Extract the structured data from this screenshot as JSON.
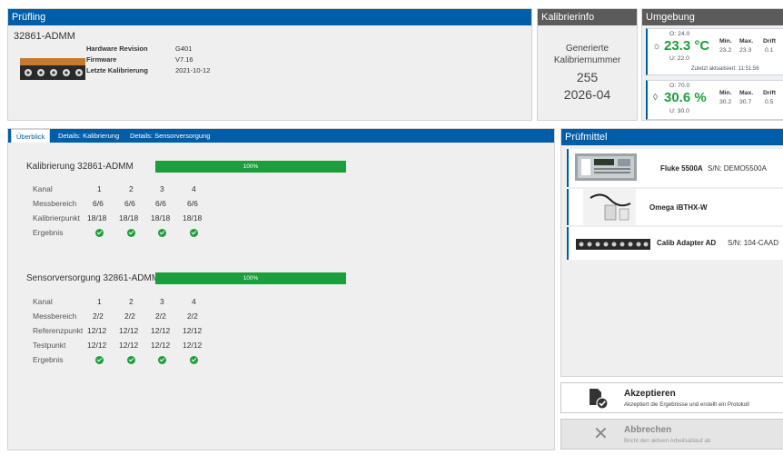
{
  "pruefling": {
    "header": "Prüfling",
    "device_name": "32861-ADMM",
    "hardware_label": "Hardware Revision",
    "hardware_value": "G401",
    "firmware_label": "Firmware",
    "firmware_value": "V7.16",
    "lastcal_label": "Letzte Kalibrierung",
    "lastcal_value": "2021-10-12"
  },
  "kalibrierinfo": {
    "header": "Kalibrierinfo",
    "line1": "Generierte",
    "line2": "Kalibriernummer",
    "number": "255",
    "date": "2026-04"
  },
  "umgebung": {
    "header": "Umgebung",
    "temp": {
      "o": "O: 24.0",
      "value": "23.3 °C",
      "u": "U: 22.0",
      "min_label": "Min.",
      "max_label": "Max.",
      "drift_label": "Drift",
      "min": "23.2",
      "max": "23.3",
      "drift": "0.1"
    },
    "updated": "Zuletzt aktualisiert: 11:51:56",
    "hum": {
      "o": "O: 70.0",
      "value": "30.6 %",
      "u": "U: 30.0",
      "min_label": "Min.",
      "max_label": "Max.",
      "drift_label": "Drift",
      "min": "30.2",
      "max": "30.7",
      "drift": "0.5"
    }
  },
  "tabs": [
    {
      "label": "Überblick"
    },
    {
      "label": "Details: Kalibrierung"
    },
    {
      "label": "Details: Sensorversorgung"
    }
  ],
  "kalibrierung": {
    "title": "Kalibrierung 32861-ADMM",
    "progress": 100,
    "progress_label": "100%",
    "rows": [
      "Kanal",
      "Messbereich",
      "Kalibrierpunkt",
      "Ergebnis"
    ],
    "channels": [
      "1",
      "2",
      "3",
      "4"
    ],
    "messbereich": [
      "6/6",
      "6/6",
      "6/6",
      "6/6"
    ],
    "punkt": [
      "18/18",
      "18/18",
      "18/18",
      "18/18"
    ]
  },
  "sensor": {
    "title": "Sensorversorgung 32861-ADMM",
    "progress": 100,
    "progress_label": "100%",
    "rows": [
      "Kanal",
      "Messbereich",
      "Referenzpunkt",
      "Testpunkt",
      "Ergebnis"
    ],
    "channels": [
      "1",
      "2",
      "3",
      "4"
    ],
    "messbereich": [
      "2/2",
      "2/2",
      "2/2",
      "2/2"
    ],
    "referenz": [
      "12/12",
      "12/12",
      "12/12",
      "12/12"
    ],
    "test": [
      "12/12",
      "12/12",
      "12/12",
      "12/12"
    ]
  },
  "pruefmittel": {
    "header": "Prüfmittel",
    "items": [
      {
        "name": "Fluke 5500A",
        "serial": "S/N: DEMO5500A"
      },
      {
        "name": "Omega iBTHX-W",
        "serial": ""
      },
      {
        "name": "Calib Adapter AD",
        "serial": "S/N: 104-CAAD"
      }
    ]
  },
  "actions": {
    "accept_title": "Akzeptieren",
    "accept_sub": "Akzeptiert die Ergebnisse und erstellt ein Protokoll",
    "cancel_title": "Abbrechen",
    "cancel_sub": "Bricht den aktiven Arbeitsablauf ab"
  },
  "colors": {
    "accent": "#005ea8",
    "success": "#1d9e3c",
    "header_gray": "#5b5b5b"
  }
}
